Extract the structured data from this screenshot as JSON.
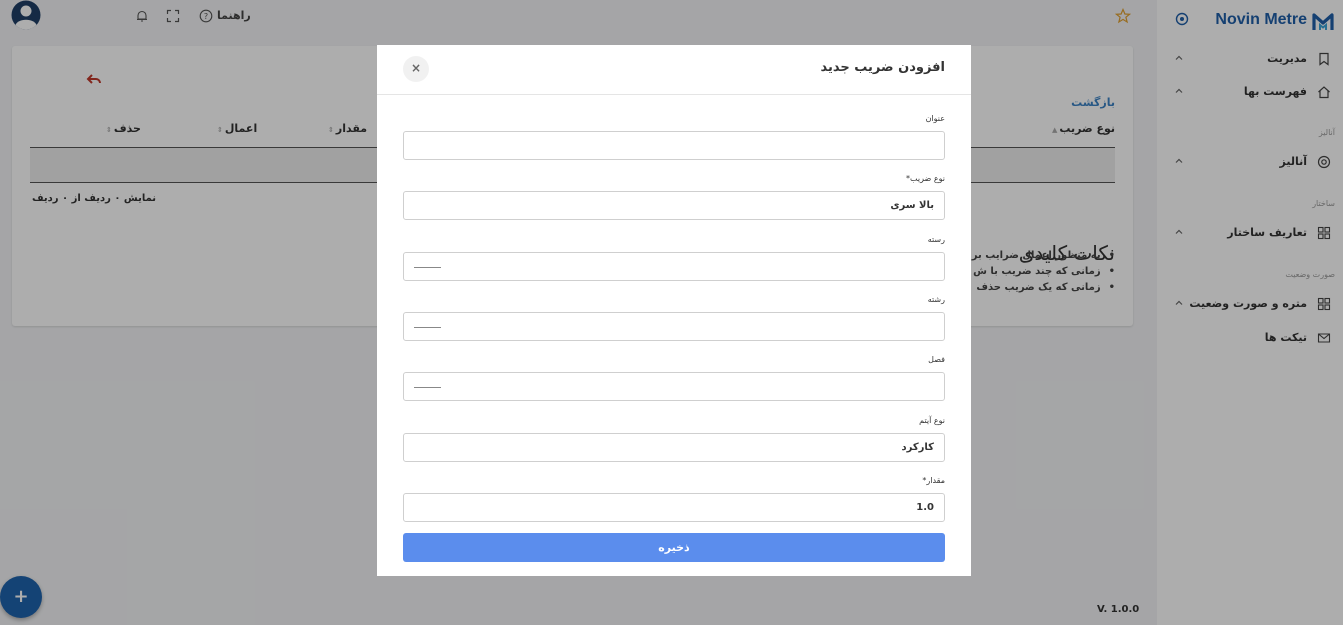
{
  "app": {
    "brand": "Novin Metre",
    "version": "V. 1.0.0"
  },
  "topbar": {
    "help_label": "راهنما"
  },
  "sidebar": {
    "items": [
      {
        "label": "مدیریت"
      },
      {
        "label": "فهرست بها"
      },
      {
        "section": "آنالیز",
        "label": "آنالیز"
      },
      {
        "section": "ساختار",
        "label": "تعاریف ساختار"
      },
      {
        "section": "صورت وضعیت",
        "label": "متره و صورت وضعیت"
      },
      {
        "label": "تیکت ها"
      }
    ]
  },
  "page": {
    "back_label": "بازگشت",
    "table": {
      "columns": [
        "نوع ضریب",
        "مقدار",
        "اعمال",
        "حذف"
      ],
      "rows": [],
      "row_count_text": "نمایش ۰ ردیف از ۰ ردیف"
    },
    "notes": {
      "title": "نکات کلیدی",
      "items": [
        "به منظور اعمال ضرایب بر",
        "زمانی که چند ضریب با ش",
        "زمانی که یک ضریب حذف"
      ]
    }
  },
  "modal": {
    "title": "افزودن ضریب جدید",
    "close_label": "×",
    "fields": {
      "title": {
        "label": "عنوان",
        "value": ""
      },
      "coef_type": {
        "label": "نوع ضریب*",
        "value": "بالا سری"
      },
      "category": {
        "label": "رسته",
        "value": ""
      },
      "discipline": {
        "label": "رشته",
        "value": ""
      },
      "chapter": {
        "label": "فصل",
        "value": ""
      },
      "item_type": {
        "label": "نوع آیتم",
        "value": "کارکرد"
      },
      "amount": {
        "label": "مقدار*",
        "value": "1.0"
      }
    },
    "save_label": "ذخیره"
  },
  "colors": {
    "accent": "#1f5fa8",
    "save_button": "#5b8ded",
    "back_arrow": "#c0392b",
    "fab": "#1e63ad"
  },
  "icons": [
    "user-avatar-icon",
    "help-circle-icon",
    "fullscreen-icon",
    "bell-icon",
    "star-icon",
    "reply-arrow-icon",
    "brand-logo-icon",
    "target-icon",
    "bookmark-icon",
    "home-icon",
    "analysis-icon",
    "grid-icon",
    "ticket-icon",
    "chevron-up-icon",
    "plus-icon",
    "close-icon"
  ]
}
